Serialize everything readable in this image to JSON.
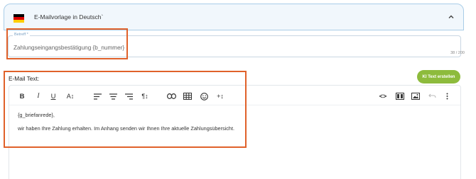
{
  "section": {
    "title": "E-Mailvorlage in Deutsch`",
    "flag_colors": [
      "#000000",
      "#dd0000",
      "#ffce00"
    ]
  },
  "subject": {
    "label": "Betreff *",
    "value": "Zahlungseingangsbestätigung {b_nummer}",
    "char_count": "38 / 200"
  },
  "email_text": {
    "label": "E-Mail Text:",
    "ai_button": "KI Text erstellen",
    "body_lines": [
      "{g_briefanrede},",
      "wir haben Ihre Zahlung erhalten. Im Anhang senden wir Ihnen Ihre aktuelle Zahlungsübersicht."
    ]
  },
  "toolbar": {
    "bold": "B",
    "italic": "I",
    "underline": "U",
    "font_size": "A↕",
    "paragraph": "¶↕",
    "insert": "+↕",
    "code": "<>",
    "icons": [
      "bold-icon",
      "italic-icon",
      "underline-icon",
      "font-size-icon",
      "align-left-icon",
      "align-center-icon",
      "align-right-icon",
      "paragraph-icon",
      "link-icon",
      "table-icon",
      "emoji-icon",
      "insert-icon",
      "code-view-icon",
      "media-icon",
      "image-icon",
      "undo-icon",
      "more-icon"
    ]
  },
  "colors": {
    "accent": "#a9cde8",
    "header_bg": "#f1f7fc",
    "ai_button": "#8dbb3c",
    "highlight": "#e0612a"
  }
}
